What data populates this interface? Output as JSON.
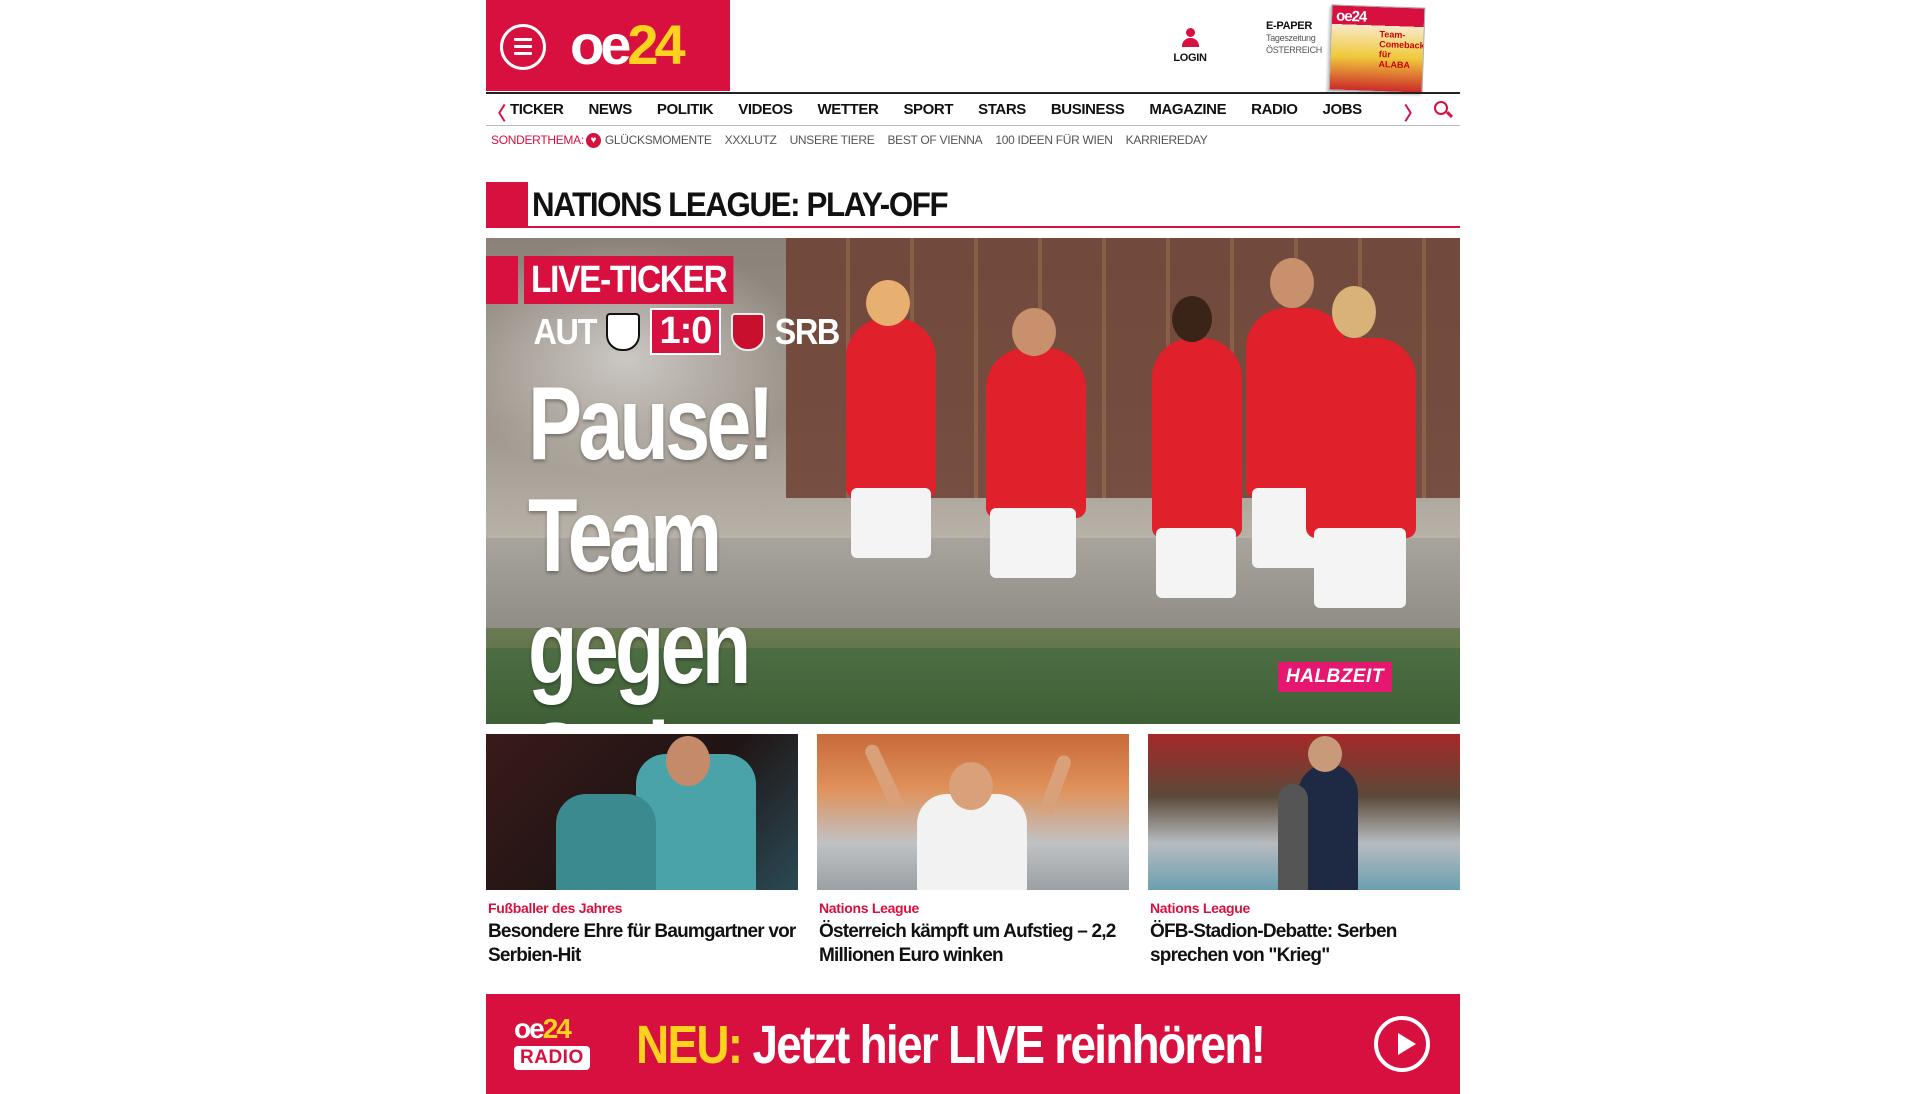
{
  "header": {
    "logo_main": "oe",
    "logo_num": "24",
    "login_label": "LOGIN",
    "epaper_title": "E-PAPER",
    "epaper_line1": "Tageszeitung",
    "epaper_line2": "ÖSTERREICH",
    "epaper_thumb_logo": "oe24",
    "epaper_thumb_headline": "Team-Comeback für ALABA"
  },
  "nav": {
    "prev": "〈",
    "next": "〉",
    "items": [
      "TICKER",
      "NEWS",
      "POLITIK",
      "VIDEOS",
      "WETTER",
      "SPORT",
      "STARS",
      "BUSINESS",
      "MAGAZINE",
      "RADIO",
      "JOBS"
    ]
  },
  "sonderthema": {
    "label": "SONDERTHEMA:",
    "items": [
      "GLÜCKSMOMENTE",
      "XXXLUTZ",
      "UNSERE TIERE",
      "BEST OF VIENNA",
      "100 IDEEN FÜR WIEN",
      "KARRIEREDAY"
    ]
  },
  "section": {
    "title": "NATIONS LEAGUE: PLAY-OFF"
  },
  "hero": {
    "ticker_label": "LIVE-TICKER",
    "team_home": "AUT",
    "team_away": "SRB",
    "score": "1:0",
    "headline": "Pause! Team gegen Serben überlegen!",
    "badge": "HALBZEIT"
  },
  "teasers": [
    {
      "category": "Fußballer des Jahres",
      "title": "Besondere Ehre für Baumgartner vor Serbien-Hit"
    },
    {
      "category": "Nations League",
      "title": "Österreich kämpft um Aufstieg – 2,2 Millionen Euro winken"
    },
    {
      "category": "Nations League",
      "title": "ÖFB-Stadion-Debatte: Serben sprechen von \"Krieg\""
    }
  ],
  "banner": {
    "logo_main": "oe",
    "logo_num": "24",
    "logo_radio": "RADIO",
    "neu": "NEU:",
    "text": "Jetzt hier LIVE reinhören!"
  },
  "colors": {
    "brand_red": "#d8103f",
    "brand_yellow": "#ffd21f",
    "badge_pink": "#e6176f"
  }
}
